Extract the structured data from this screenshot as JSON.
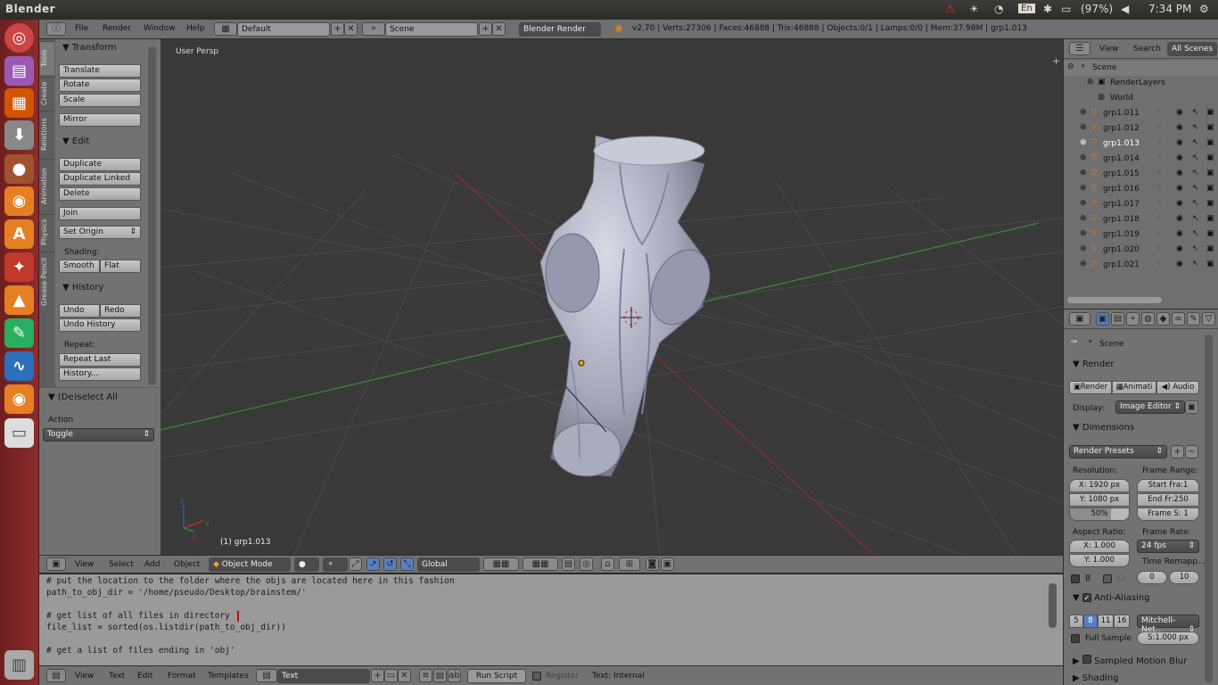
{
  "system": {
    "window_title": "Blender",
    "keyboard": "En",
    "battery": "(97%)",
    "clock": "7:34 PM"
  },
  "header": {
    "menus": [
      "File",
      "Render",
      "Window",
      "Help"
    ],
    "layout": "Default",
    "scene": "Scene",
    "engine": "Blender Render",
    "stats": "v2.70 | Verts:27306 | Faces:46888 | Tris:46888 | Objects:0/1 | Lamps:0/0 | Mem:37.98M | grp1.013"
  },
  "toolshelf": {
    "tabs": [
      "Tools",
      "Create",
      "Relations",
      "Animation",
      "Physics",
      "Grease Pencil"
    ],
    "transform": {
      "title": "Transform",
      "buttons": [
        "Translate",
        "Rotate",
        "Scale",
        "Mirror"
      ]
    },
    "edit": {
      "title": "Edit",
      "buttons": [
        "Duplicate",
        "Duplicate Linked",
        "Delete",
        "Join"
      ],
      "set_origin": "Set Origin",
      "shading_label": "Shading:",
      "smooth": "Smooth",
      "flat": "Flat"
    },
    "history": {
      "title": "History",
      "undo": "Undo",
      "redo": "Redo",
      "undo_history": "Undo History",
      "repeat_label": "Repeat:",
      "repeat_last": "Repeat Last",
      "history": "History..."
    },
    "operator": {
      "title": "(De)select All",
      "action_label": "Action",
      "action_value": "Toggle"
    }
  },
  "viewport": {
    "view_label": "User Persp",
    "object_label": "(1) grp1.013"
  },
  "view3d_header": {
    "menus": [
      "View",
      "Select",
      "Add",
      "Object"
    ],
    "mode": "Object Mode",
    "orientation": "Global"
  },
  "text_editor": {
    "lines": [
      "# put the location to the folder where the objs are located here in this fashion",
      "path_to_obj_dir = '/home/pseudo/Desktop/brainstem/'",
      "",
      "# get list of all files in directory",
      "file_list = sorted(os.listdir(path_to_obj_dir))",
      "",
      "# get a list of files ending in 'obj'"
    ],
    "menus": [
      "View",
      "Text",
      "Edit",
      "Format",
      "Templates"
    ],
    "text_name": "Text",
    "run_script": "Run Script",
    "register": "Register",
    "status": "Text: Internal"
  },
  "outliner": {
    "menus": [
      "View",
      "Search"
    ],
    "filter": "All Scenes",
    "items": [
      "Scene",
      "RenderLayers",
      "World",
      "grp1.011",
      "grp1.012",
      "grp1.013",
      "grp1.014",
      "grp1.015",
      "grp1.016",
      "grp1.017",
      "grp1.018",
      "grp1.019",
      "grp1.020",
      "grp1.021"
    ]
  },
  "properties": {
    "context": "Scene",
    "render": {
      "title": "Render",
      "render_btn": "Render",
      "anim_btn": "Animati",
      "audio_btn": "Audio",
      "display_label": "Display:",
      "display_value": "Image Editor"
    },
    "dimensions": {
      "title": "Dimensions",
      "presets": "Render Presets",
      "resolution_label": "Resolution:",
      "res_x": "X: 1920 px",
      "res_y": "Y: 1080 px",
      "res_pct": "50%",
      "frame_range_label": "Frame Range:",
      "start": "Start Fra:1",
      "end": "End Fr:250",
      "step": "Frame S: 1",
      "aspect_label": "Aspect Ratio:",
      "asp_x": "X:",
      "asp_x_val": "1.000",
      "asp_y": "Y:",
      "asp_y_val": "1.000",
      "frame_rate_label": "Frame Rate:",
      "fps": "24 fps",
      "remap_label": "Time Remapp...",
      "b_label": "B",
      "cr_label": "Cr",
      "remap_old": "0",
      "remap_new": "10"
    },
    "aa": {
      "title": "Anti-Aliasing",
      "samples": [
        "5",
        "8",
        "11",
        "16"
      ],
      "filter": "Mitchell-Net...",
      "full_sample": "Full Sample",
      "size": "S:1.000 px"
    },
    "motion_blur": "Sampled Motion Blur",
    "shading": "Shading"
  },
  "colors": {
    "accent": "#5680c2",
    "x_axis": "#8a2a2a",
    "y_axis": "#2e8a2e"
  }
}
